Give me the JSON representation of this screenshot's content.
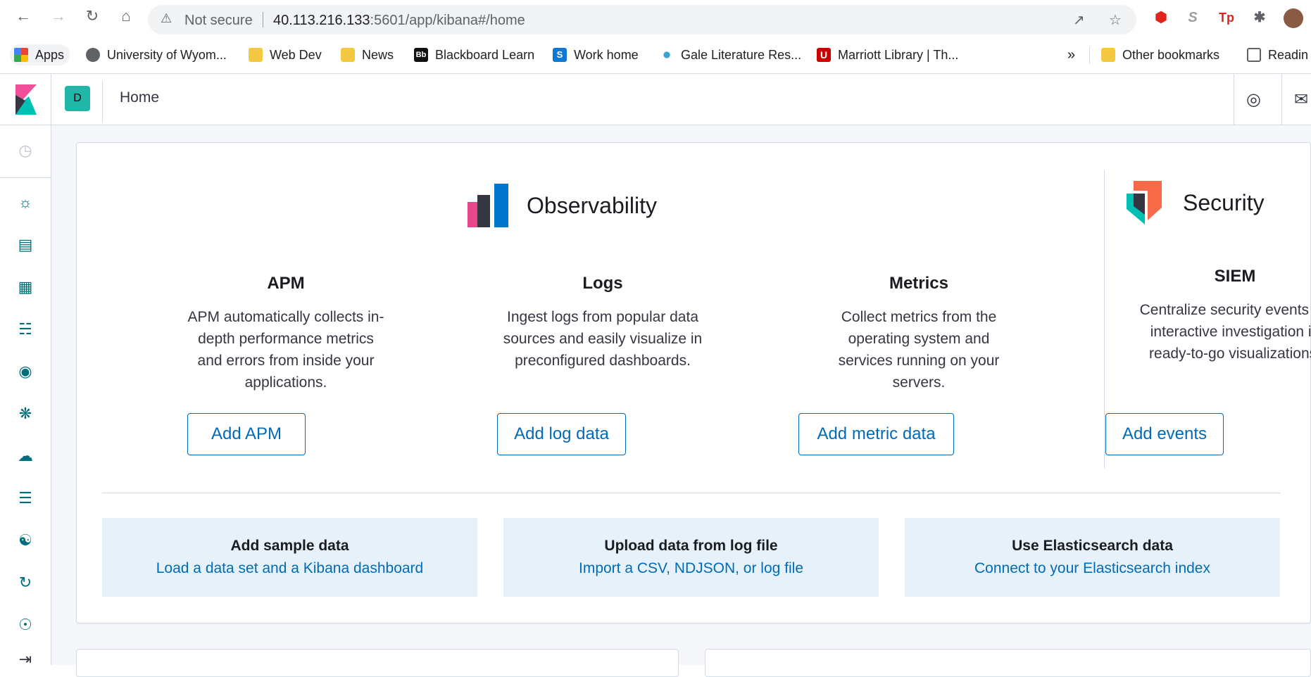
{
  "browser": {
    "not_secure": "Not secure",
    "url_host": "40.113.216.133",
    "url_rest": ":5601/app/kibana#/home",
    "bookmarks": [
      {
        "label": "Apps"
      },
      {
        "label": "University of Wyom..."
      },
      {
        "label": "Web Dev"
      },
      {
        "label": "News"
      },
      {
        "label": "Blackboard Learn"
      },
      {
        "label": "Work home"
      },
      {
        "label": "Gale Literature Res..."
      },
      {
        "label": "Marriott Library | Th..."
      },
      {
        "label": "Other bookmarks"
      },
      {
        "label": "Readin"
      }
    ],
    "more_bookmarks": "»"
  },
  "kibana": {
    "space_initial": "D",
    "page_title": "Home"
  },
  "solutions": {
    "observability": {
      "title": "Observability"
    },
    "security": {
      "title": "Security"
    },
    "apm": {
      "title": "APM",
      "desc": "APM automatically collects in-depth performance metrics and errors from inside your applications.",
      "button": "Add APM"
    },
    "logs": {
      "title": "Logs",
      "desc": "Ingest logs from popular data sources and easily visualize in preconfigured dashboards.",
      "button": "Add log data"
    },
    "metrics": {
      "title": "Metrics",
      "desc": "Collect metrics from the operating system and services running on your servers.",
      "button": "Add metric data"
    },
    "siem": {
      "title": "SIEM",
      "desc": "Centralize security events for interactive investigation in ready-to-go visualizations.",
      "button": "Add events"
    }
  },
  "data_sources": [
    {
      "title": "Add sample data",
      "link": "Load a data set and a Kibana dashboard"
    },
    {
      "title": "Upload data from log file",
      "link": "Import a CSV, NDJSON, or log file"
    },
    {
      "title": "Use Elasticsearch data",
      "link": "Connect to your Elasticsearch index"
    }
  ],
  "colors": {
    "accent": "#006bb8",
    "teal": "#20b7a8",
    "panel_light": "#e6f1fa"
  }
}
